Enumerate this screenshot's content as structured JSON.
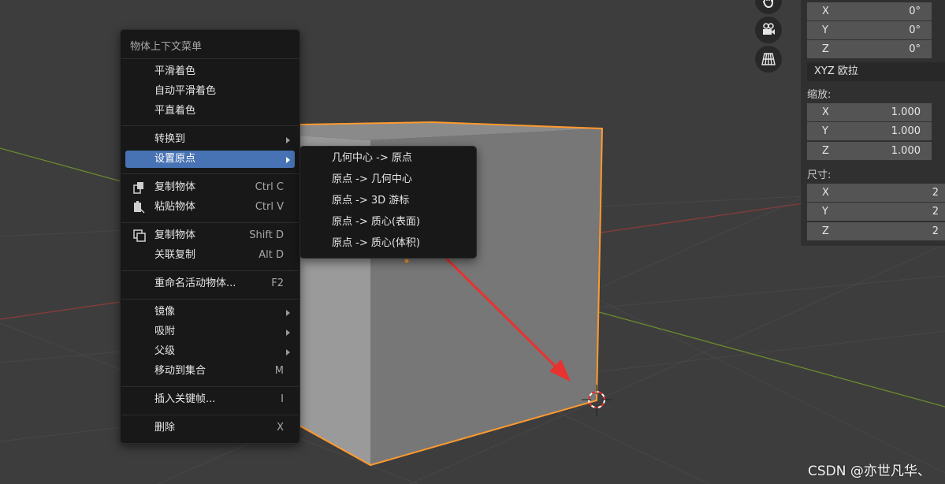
{
  "context_menu": {
    "title": "物体上下文菜单",
    "items": [
      {
        "label": "平滑着色"
      },
      {
        "label": "自动平滑着色"
      },
      {
        "label": "平直着色"
      },
      {
        "label": "转换到"
      },
      {
        "label": "设置原点"
      },
      {
        "label": "复制物体",
        "shortcut": "Ctrl C",
        "icon": "copy-icon"
      },
      {
        "label": "粘贴物体",
        "shortcut": "Ctrl V",
        "icon": "paste-icon"
      },
      {
        "label": "复制物体",
        "shortcut": "Shift D",
        "icon": "duplicate-icon"
      },
      {
        "label": "关联复制",
        "shortcut": "Alt D"
      },
      {
        "label": "重命名活动物体...",
        "shortcut": "F2"
      },
      {
        "label": "镜像"
      },
      {
        "label": "吸附"
      },
      {
        "label": "父级"
      },
      {
        "label": "移动到集合",
        "shortcut": "M"
      },
      {
        "label": "插入关键帧...",
        "shortcut": "I"
      },
      {
        "label": "删除",
        "shortcut": "X"
      }
    ]
  },
  "origin_submenu": {
    "items": [
      {
        "label": "几何中心 -> 原点"
      },
      {
        "label": "原点 -> 几何中心"
      },
      {
        "label": "原点 -> 3D 游标"
      },
      {
        "label": "原点 -> 质心(表面)"
      },
      {
        "label": "原点 -> 质心(体积)"
      }
    ]
  },
  "properties": {
    "rotation": [
      {
        "axis": "X",
        "value": "0°"
      },
      {
        "axis": "Y",
        "value": "0°"
      },
      {
        "axis": "Z",
        "value": "0°"
      }
    ],
    "rotation_mode": "XYZ 欧拉",
    "scale_label": "缩放:",
    "scale": [
      {
        "axis": "X",
        "value": "1.000"
      },
      {
        "axis": "Y",
        "value": "1.000"
      },
      {
        "axis": "Z",
        "value": "1.000"
      }
    ],
    "dimensions_label": "尺寸:",
    "dimensions": [
      {
        "axis": "X",
        "value": "2"
      },
      {
        "axis": "Y",
        "value": "2"
      },
      {
        "axis": "Z",
        "value": "2"
      }
    ]
  },
  "viewport_gizmos": [
    "hand-pan-icon",
    "camera-icon",
    "grid-perspective-icon"
  ],
  "watermark": "CSDN @亦世凡华、",
  "colors": {
    "accent": "#4772b3",
    "selection_outline": "#ff9a2e",
    "annotation_arrow": "#e8322f",
    "x_axis": "#8a3b3b",
    "y_axis": "#6b8a2e"
  }
}
